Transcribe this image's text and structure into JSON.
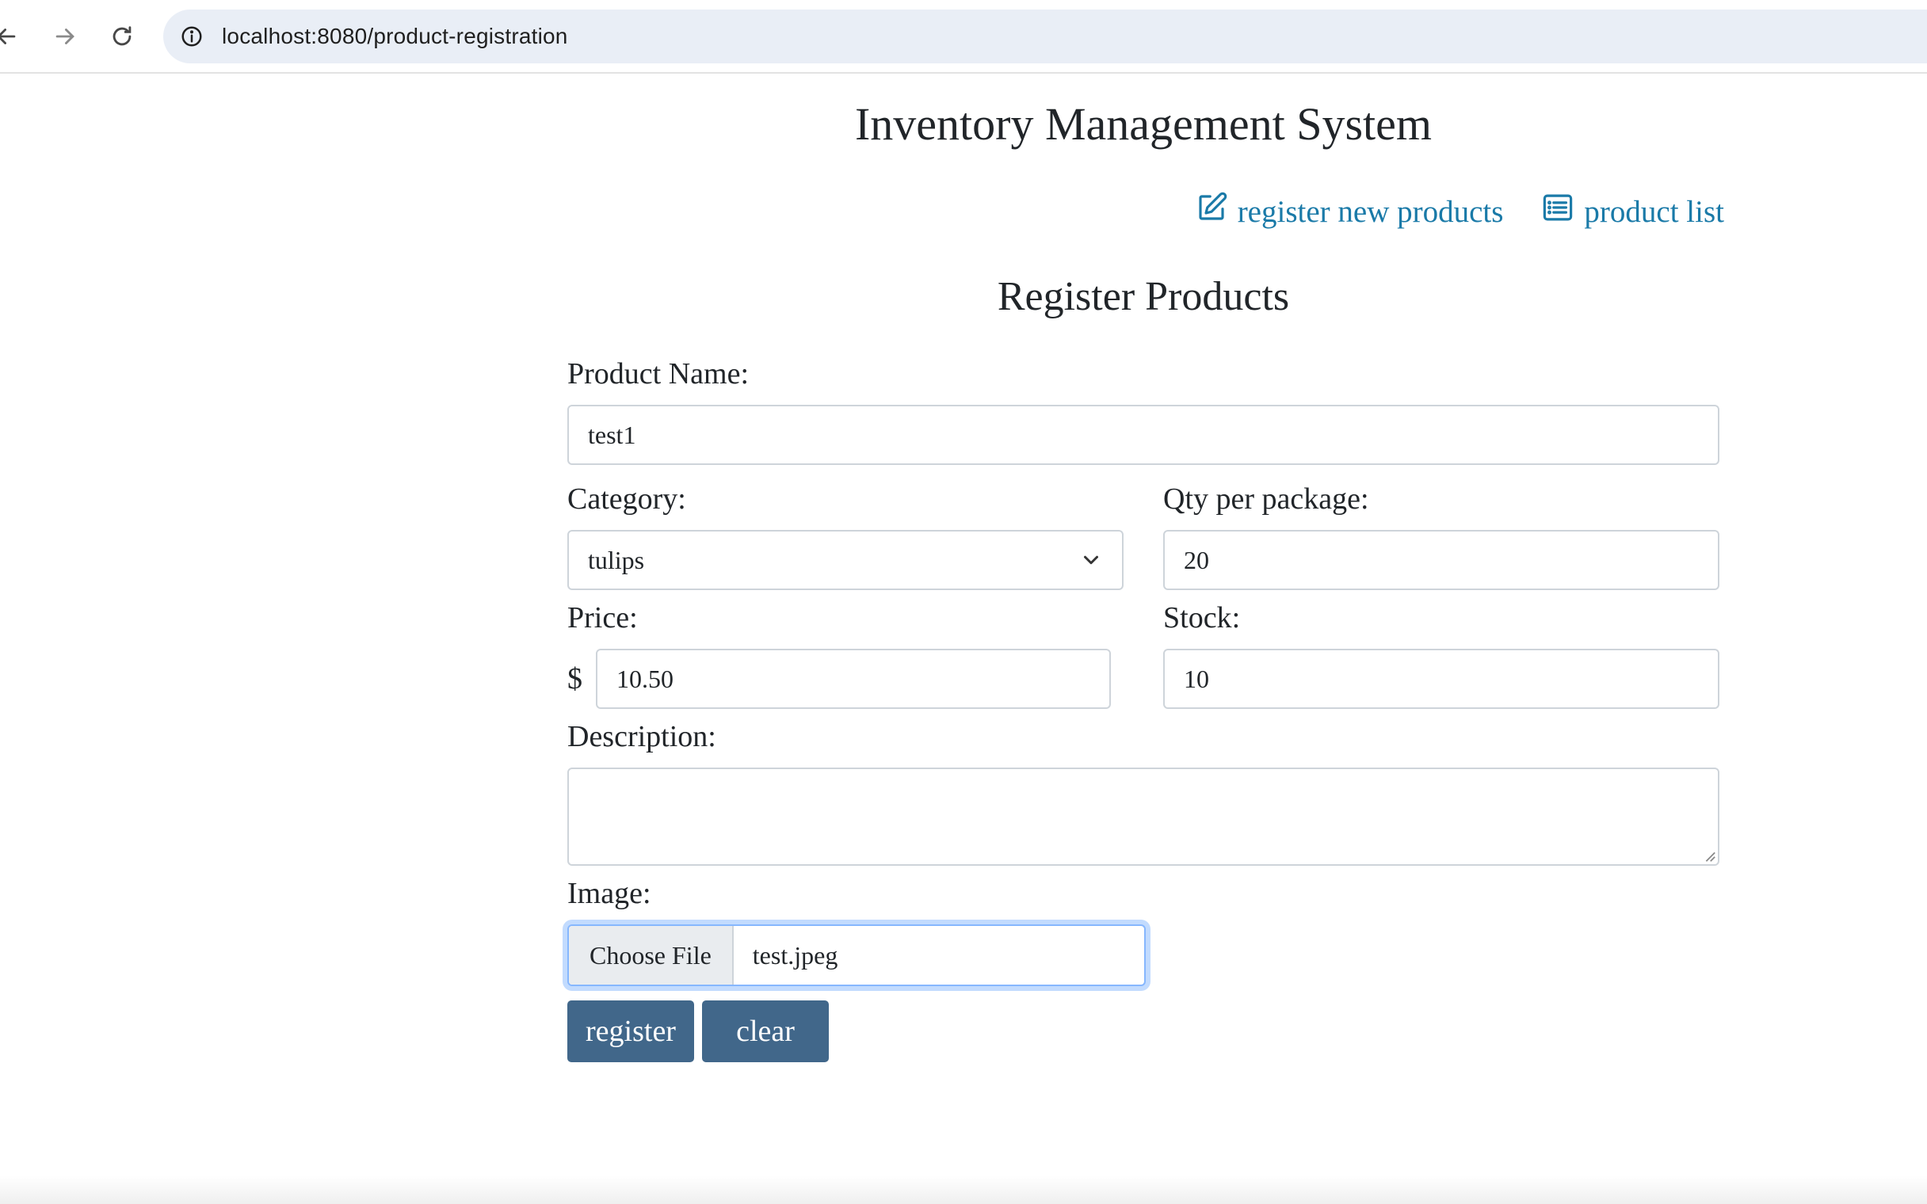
{
  "browser": {
    "url": "localhost:8080/product-registration"
  },
  "header": {
    "title": "Inventory Management System",
    "nav": {
      "register_label": "register new products",
      "list_label": "product list"
    }
  },
  "form": {
    "heading": "Register Products",
    "product_name": {
      "label": "Product Name",
      "value": "test1"
    },
    "category": {
      "label": "Category",
      "value": "tulips"
    },
    "qty_per_package": {
      "label": "Qty per package",
      "value": "20"
    },
    "price": {
      "label": "Price",
      "currency": "$",
      "value": "10.50"
    },
    "stock": {
      "label": "Stock",
      "value": "10"
    },
    "description": {
      "label": "Description",
      "value": ""
    },
    "image": {
      "label": "Image",
      "button_label": "Choose File",
      "file_name": "test.jpeg"
    },
    "buttons": {
      "register_label": "register",
      "clear_label": "clear"
    }
  },
  "colors": {
    "link": "#1a7aa8",
    "button": "#41678a",
    "focus_ring": "#86b7fe"
  }
}
